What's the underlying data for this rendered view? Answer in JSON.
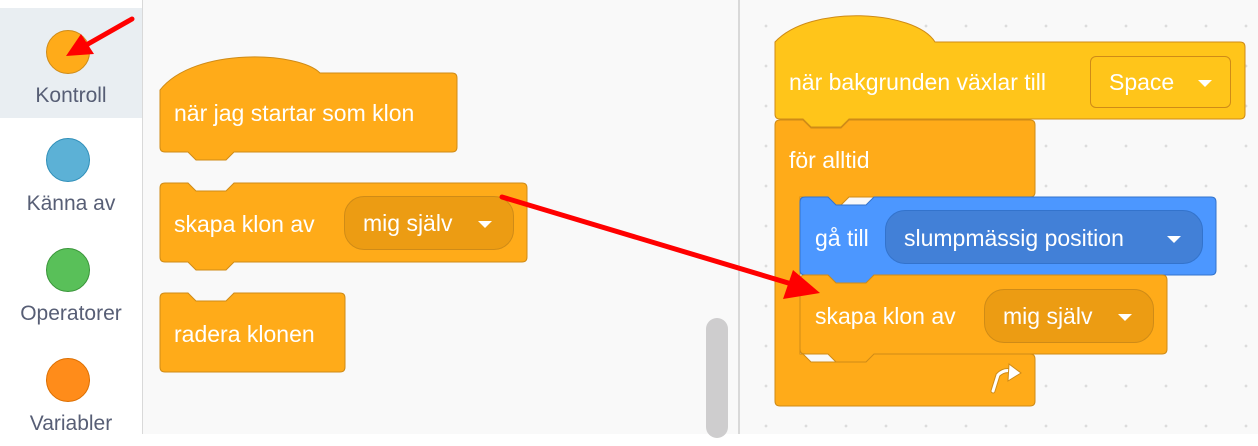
{
  "categories": [
    {
      "label": "Kontroll",
      "color": "#FFAB19",
      "border": "#CF8B17",
      "selected": true
    },
    {
      "label": "Känna av",
      "color": "#5CB1D6",
      "border": "#2E8EB8",
      "selected": false
    },
    {
      "label": "Operatorer",
      "color": "#59C059",
      "border": "#389438",
      "selected": false
    },
    {
      "label": "Variabler",
      "color": "#FF8C1A",
      "border": "#DB6E00",
      "selected": false
    }
  ],
  "flyout": {
    "hat_block": "när jag startar som klon",
    "create_clone": {
      "label": "skapa klon av",
      "dropdown": "mig själv"
    },
    "delete_clone": "radera klonen"
  },
  "workspace": {
    "when_backdrop": {
      "label": "när bakgrunden växlar till",
      "dropdown": "Space"
    },
    "forever": "för alltid",
    "goto": {
      "label": "gå till",
      "dropdown": "slumpmässig position"
    },
    "create_clone": {
      "label": "skapa klon av",
      "dropdown": "mig själv"
    }
  },
  "colors": {
    "control": "#FFAB19",
    "control_border": "#CF8B17",
    "control_dropdown": "#EC9C13",
    "motion": "#4C97FF",
    "motion_border": "#3373CC",
    "motion_dropdown": "#4280D7",
    "arrow": "#FF0000"
  }
}
